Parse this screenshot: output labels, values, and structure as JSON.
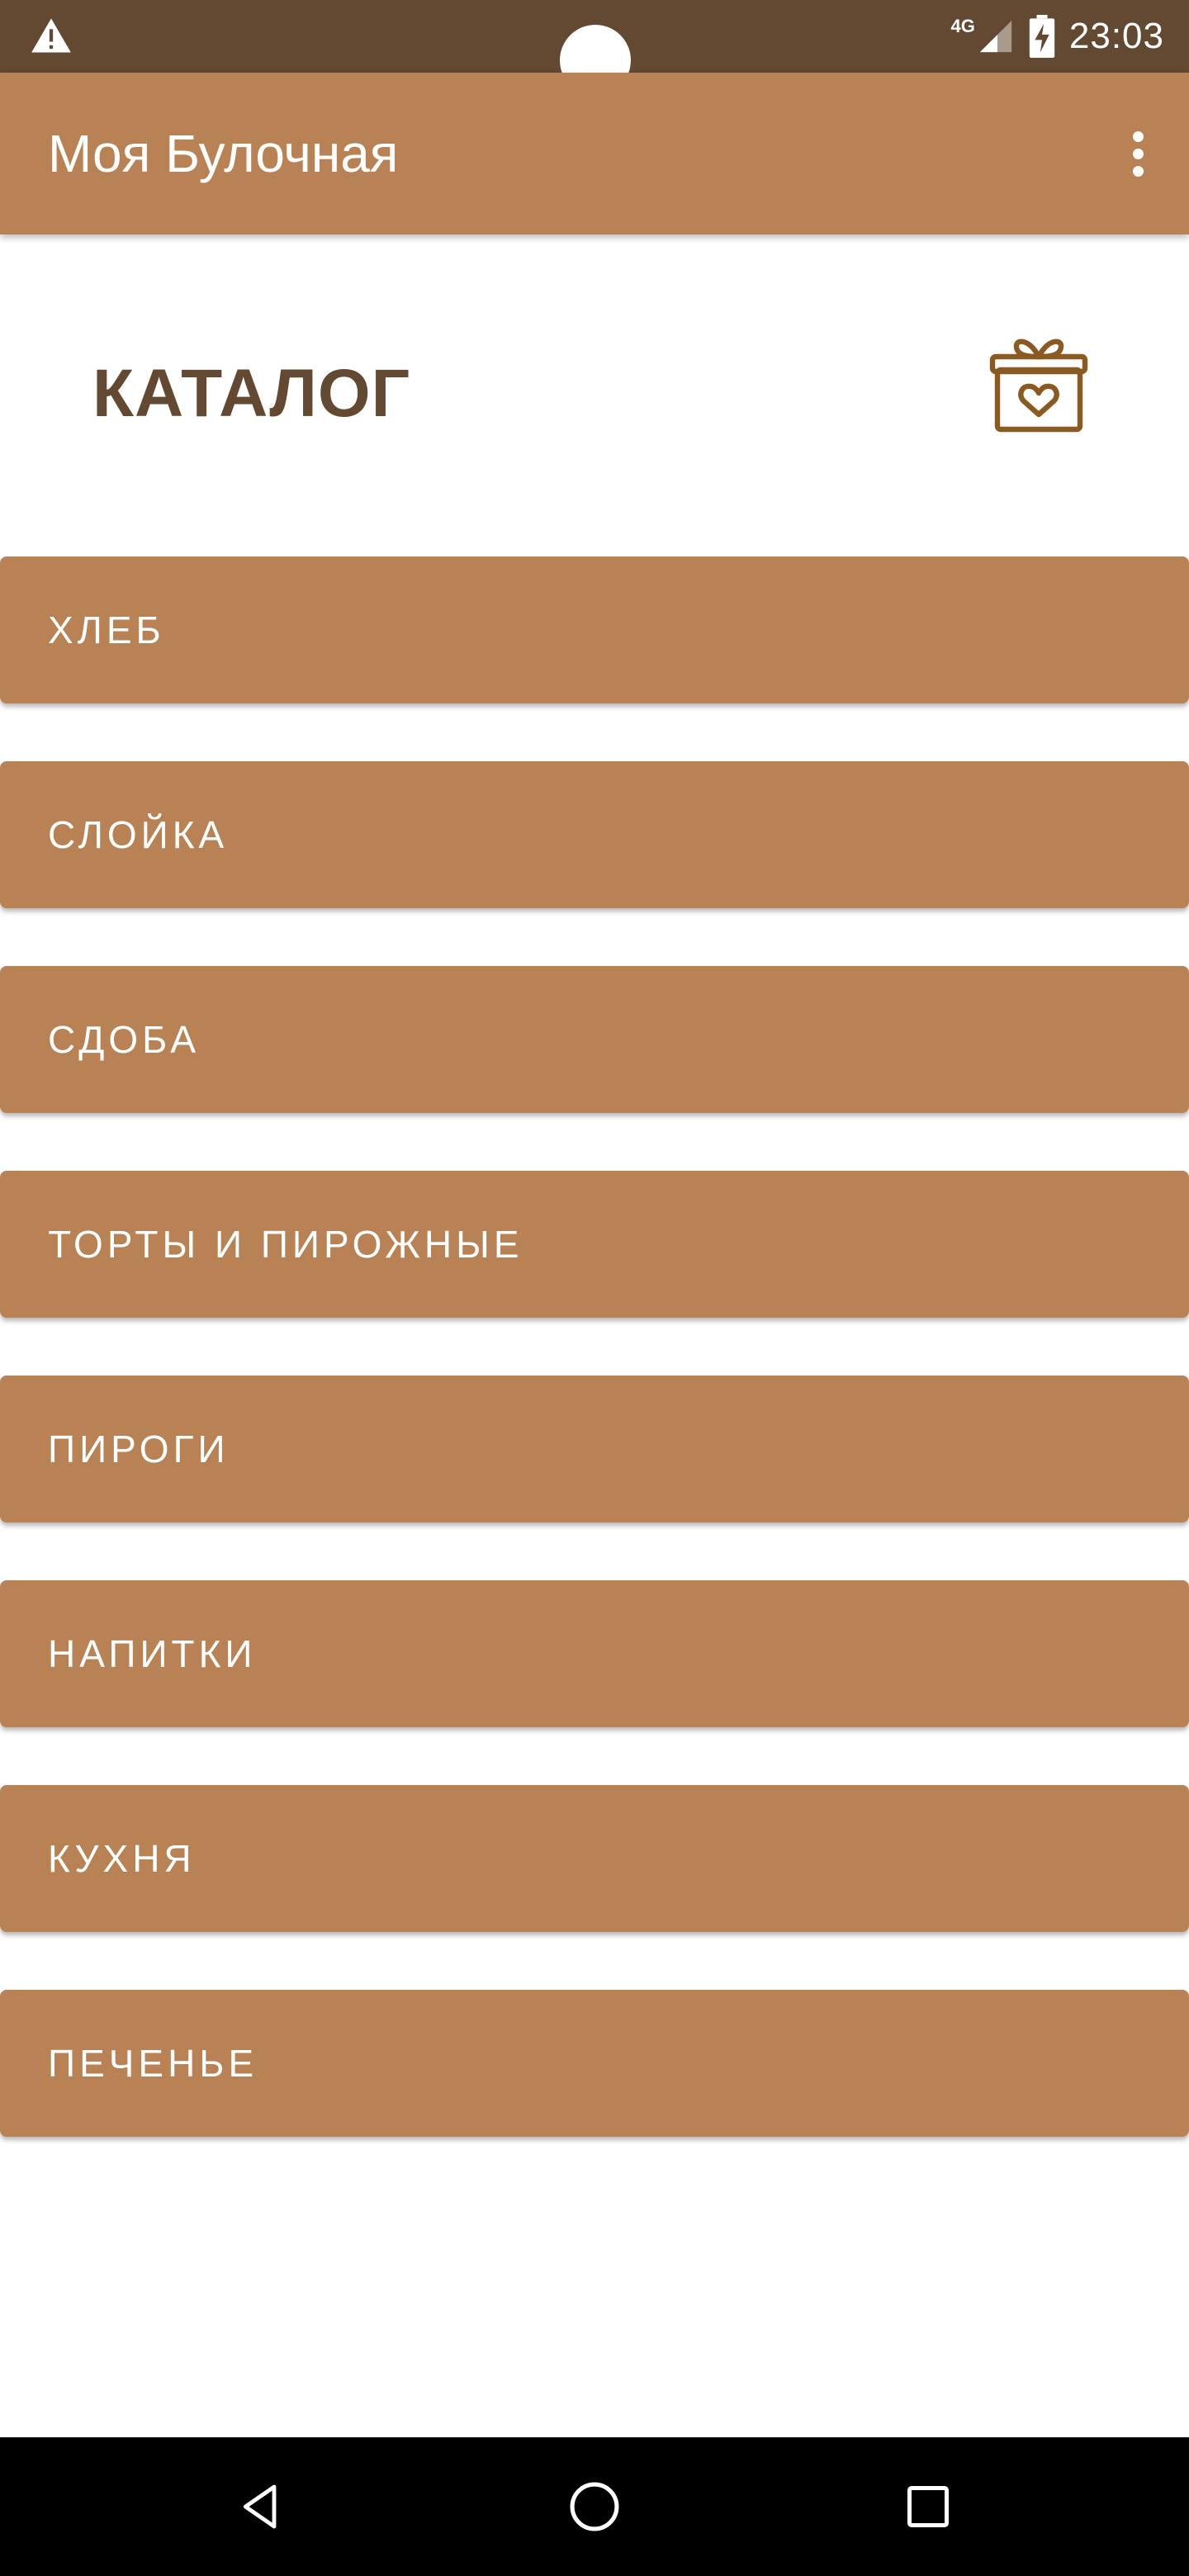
{
  "status_bar": {
    "time": "23:03",
    "network": "4G",
    "icons": [
      "warning-icon",
      "signal-icon",
      "battery-charging-icon"
    ],
    "bg_color": "#634832"
  },
  "app_bar": {
    "title": "Моя Булочная",
    "menu_icon": "more-vert-icon",
    "bg_color": "#b98254"
  },
  "header": {
    "title": "КАТАЛОГ",
    "icon": "gift-icon",
    "title_color": "#634832"
  },
  "categories": [
    {
      "label": "ХЛЕБ"
    },
    {
      "label": "СЛОЙКА"
    },
    {
      "label": "СДОБА"
    },
    {
      "label": "ТОРТЫ И ПИРОЖНЫЕ"
    },
    {
      "label": "ПИРОГИ"
    },
    {
      "label": "НАПИТКИ"
    },
    {
      "label": "КУХНЯ"
    },
    {
      "label": "ПЕЧЕНЬЕ"
    }
  ],
  "nav_bar": {
    "buttons": [
      "back-icon",
      "home-icon",
      "recents-icon"
    ]
  }
}
